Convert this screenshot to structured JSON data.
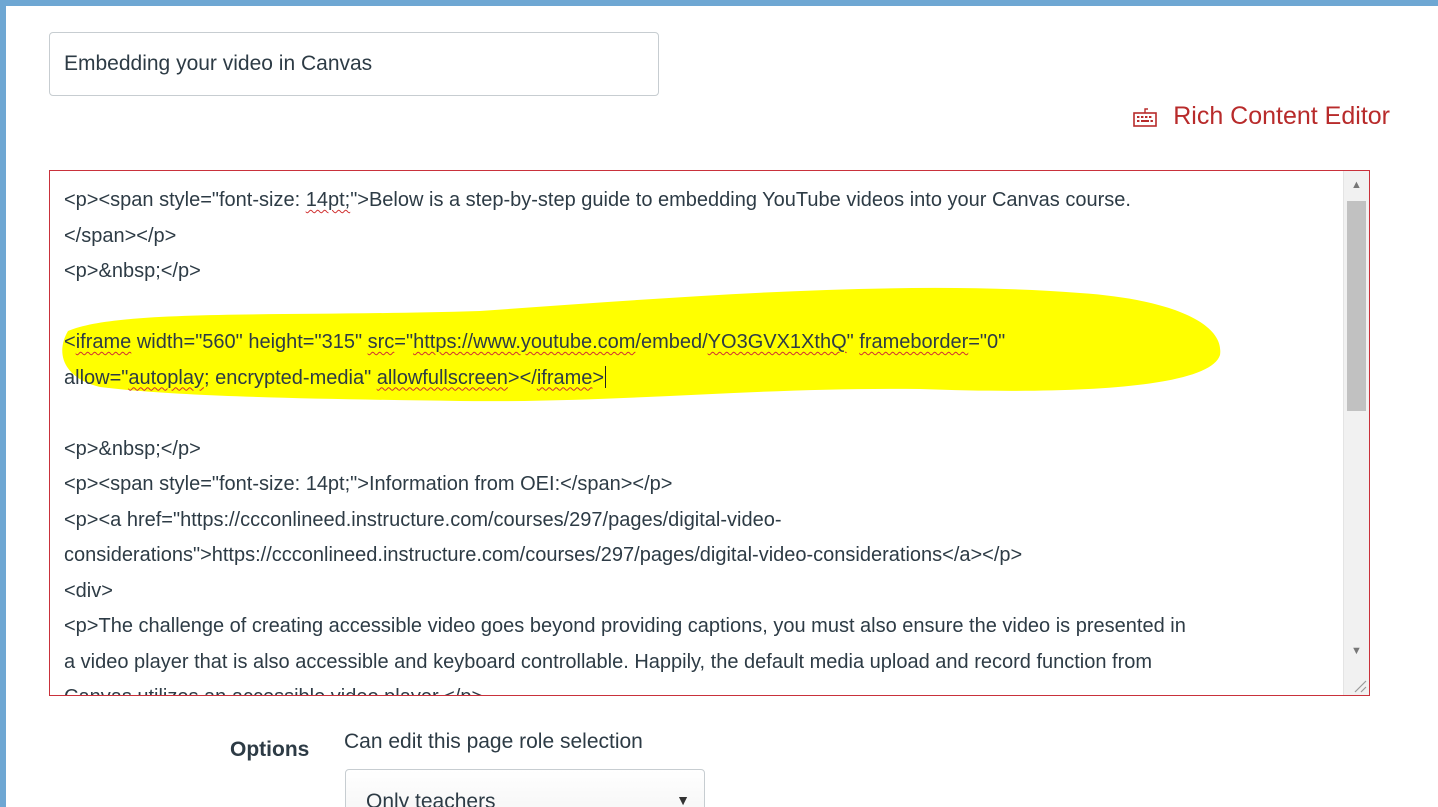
{
  "page": {
    "title_value": "Embedding your video in Canvas",
    "rce_toggle_label": "Rich Content Editor",
    "options_label": "Options",
    "role_selection_label": "Can edit this page role selection",
    "role_selection_value": "Only teachers"
  },
  "editor": {
    "lines": [
      [
        "<p><span style=\"font-size: ",
        {
          "t": "14pt;",
          "sp": true
        },
        "\">Below is a step-by-step guide to embedding YouTube videos into your Canvas course."
      ],
      [
        "</span></p>"
      ],
      [
        "<p>&nbsp;</p>"
      ],
      [
        ""
      ],
      [
        "<",
        {
          "t": "iframe",
          "sp": true
        },
        " width=\"560\" height=\"315\" ",
        {
          "t": "src",
          "sp": true
        },
        "=\"",
        {
          "t": "https://www.youtube.com",
          "sp": true
        },
        "/embed/",
        {
          "t": "YO3GVX1XthQ",
          "sp": true
        },
        "\" ",
        {
          "t": "frameborder",
          "sp": true
        },
        "=\"0\""
      ],
      [
        "allow=\"",
        {
          "t": "autoplay",
          "sp": true
        },
        "; encrypted-media\" ",
        {
          "t": "allowfullscreen",
          "sp": true
        },
        "></",
        {
          "t": "iframe",
          "sp": true
        },
        ">",
        {
          "caret": true
        }
      ],
      [
        ""
      ],
      [
        "<p>&nbsp;</p>"
      ],
      [
        "<p><span style=\"font-size: 14pt;\">Information from OEI:</span></p>"
      ],
      [
        "<p><a href=\"https://ccconlineed.instructure.com/courses/297/pages/digital-video-"
      ],
      [
        "considerations\">https://ccconlineed.instructure.com/courses/297/pages/digital-video-considerations</a></p>"
      ],
      [
        "<div>"
      ],
      [
        "<p>The challenge of creating accessible video goes beyond providing captions, you must also ensure the video is presented in"
      ],
      [
        "a video player that is also accessible and keyboard controllable. Happily, the default media upload and record function from"
      ],
      [
        "Canvas utilizes an accessible video player.</p>"
      ]
    ]
  },
  "colors": {
    "accent": "#b82b2b",
    "highlight": "#ffff00",
    "frame": "#6ea7d3"
  },
  "icons": {
    "rce": "keyboard-icon",
    "select": "caret-down-icon"
  }
}
